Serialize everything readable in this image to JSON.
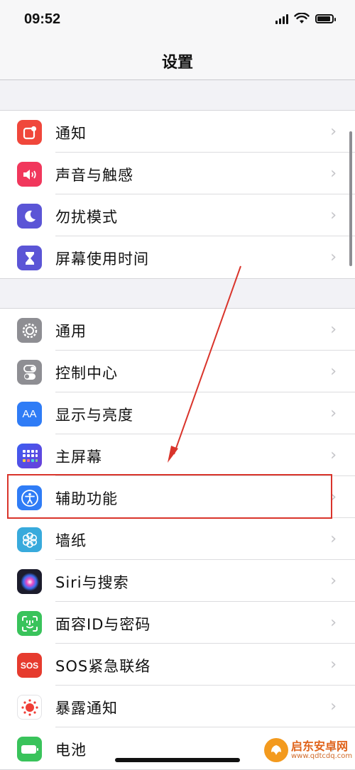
{
  "status": {
    "time": "09:52"
  },
  "nav": {
    "title": "设置"
  },
  "groups": [
    {
      "items": [
        {
          "label": "通知",
          "icon": "notifications-icon",
          "color": "#f0473b"
        },
        {
          "label": "声音与触感",
          "icon": "speaker-icon",
          "color": "#f1375c"
        },
        {
          "label": "勿扰模式",
          "icon": "moon-icon",
          "color": "#5b55d6"
        },
        {
          "label": "屏幕使用时间",
          "icon": "hourglass-icon",
          "color": "#5b55d6"
        }
      ]
    },
    {
      "items": [
        {
          "label": "通用",
          "icon": "gear-icon",
          "color": "#8e8e93"
        },
        {
          "label": "控制中心",
          "icon": "toggles-icon",
          "color": "#8e8e93"
        },
        {
          "label": "显示与亮度",
          "icon": "text-size-icon",
          "color": "#2f7cf6",
          "glyph": "AA"
        },
        {
          "label": "主屏幕",
          "icon": "home-screen-icon",
          "color": "#3b5ef1"
        },
        {
          "label": "辅助功能",
          "icon": "accessibility-icon",
          "color": "#2f7cf6"
        },
        {
          "label": "墙纸",
          "icon": "flower-icon",
          "color": "#38aadc"
        },
        {
          "label": "Siri与搜索",
          "icon": "siri-icon",
          "color": "#1c1c2c"
        },
        {
          "label": "面容ID与密码",
          "icon": "face-id-icon",
          "color": "#39c35b"
        },
        {
          "label": "SOS紧急联络",
          "icon": "sos-icon",
          "color": "#e63b2e",
          "glyph": "SOS"
        },
        {
          "label": "暴露通知",
          "icon": "exposure-icon",
          "color": "#ffffff"
        },
        {
          "label": "电池",
          "icon": "battery-icon",
          "color": "#39c35b"
        }
      ]
    }
  ],
  "watermark": {
    "cn": "启东安卓网",
    "en": "www.qdtcdq.com"
  }
}
